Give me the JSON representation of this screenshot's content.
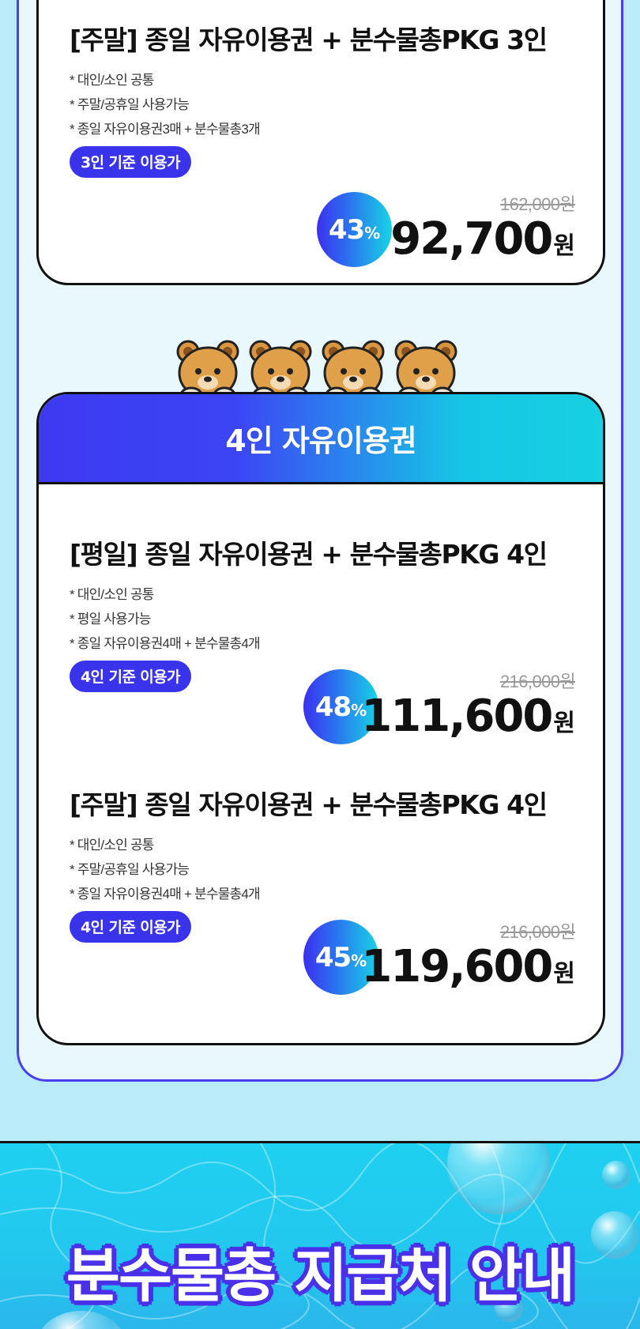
{
  "section_3p": {
    "product_weekend": {
      "title": "[주말] 종일 자유이용권 + 분수물총PKG 3인",
      "notes": [
        "* 대인/소인 공통",
        "* 주말/공휴일 사용가능",
        "* 종일 자유이용권3매 + 분수물총3개"
      ],
      "badge": "3인 기준 이용가",
      "discount": "43",
      "discount_unit": "%",
      "original_price": "162,000원",
      "sale_price": "92,700",
      "currency": "원"
    }
  },
  "section_4p": {
    "header": "4인 자유이용권",
    "product_weekday": {
      "title": "[평일] 종일 자유이용권 + 분수물총PKG 4인",
      "notes": [
        "* 대인/소인 공통",
        "* 평일 사용가능",
        "* 종일 자유이용권4매 + 분수물총4개"
      ],
      "badge": "4인 기준 이용가",
      "discount": "48",
      "discount_unit": "%",
      "original_price": "216,000원",
      "sale_price": "111,600",
      "currency": "원"
    },
    "product_weekend": {
      "title": "[주말] 종일 자유이용권 + 분수물총PKG 4인",
      "notes": [
        "* 대인/소인 공통",
        "* 주말/공휴일 사용가능",
        "* 종일 자유이용권4매 + 분수물총4개"
      ],
      "badge": "4인 기준 이용가",
      "discount": "45",
      "discount_unit": "%",
      "original_price": "216,000원",
      "sale_price": "119,600",
      "currency": "원"
    }
  },
  "promo": {
    "title": "분수물총 지급처 안내"
  },
  "icons": [
    "bear-icon",
    "water-bubble-icon"
  ],
  "colors": {
    "accent": "#3a33ec",
    "cyan": "#17d0e2",
    "panel_bg": "#e9f8fd",
    "page_bg": "#b9ecf8"
  }
}
